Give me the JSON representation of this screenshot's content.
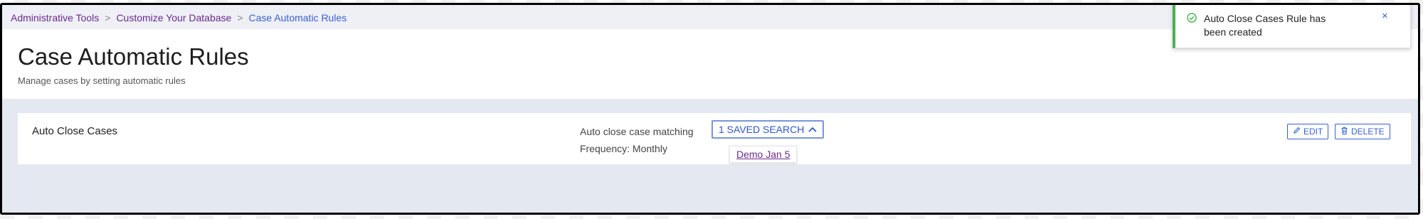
{
  "breadcrumb": {
    "items": [
      "Administrative Tools",
      "Customize Your Database",
      "Case Automatic Rules"
    ],
    "separator": ">"
  },
  "header": {
    "title": "Case Automatic Rules",
    "subtitle": "Manage cases by setting automatic rules"
  },
  "rule": {
    "name": "Auto Close Cases",
    "match_label": "Auto close case matching",
    "saved_search_label": "1 SAVED SEARCH",
    "frequency": "Frequency: Monthly",
    "saved_searches": [
      "Demo Jan 5"
    ],
    "edit_label": "EDIT",
    "delete_label": "DELETE"
  },
  "toast": {
    "message": "Auto Close Cases Rule has been created",
    "close_glyph": "×",
    "status_color": "#4caf50"
  },
  "icons": {
    "toast": "check-circle-icon",
    "saved_search": "chevron-up-icon",
    "edit": "pencil-icon",
    "delete": "trash-icon"
  },
  "colors": {
    "link": "#3a5fd0",
    "visited": "#6a2a8c",
    "page_bg": "#e4e8f0"
  }
}
